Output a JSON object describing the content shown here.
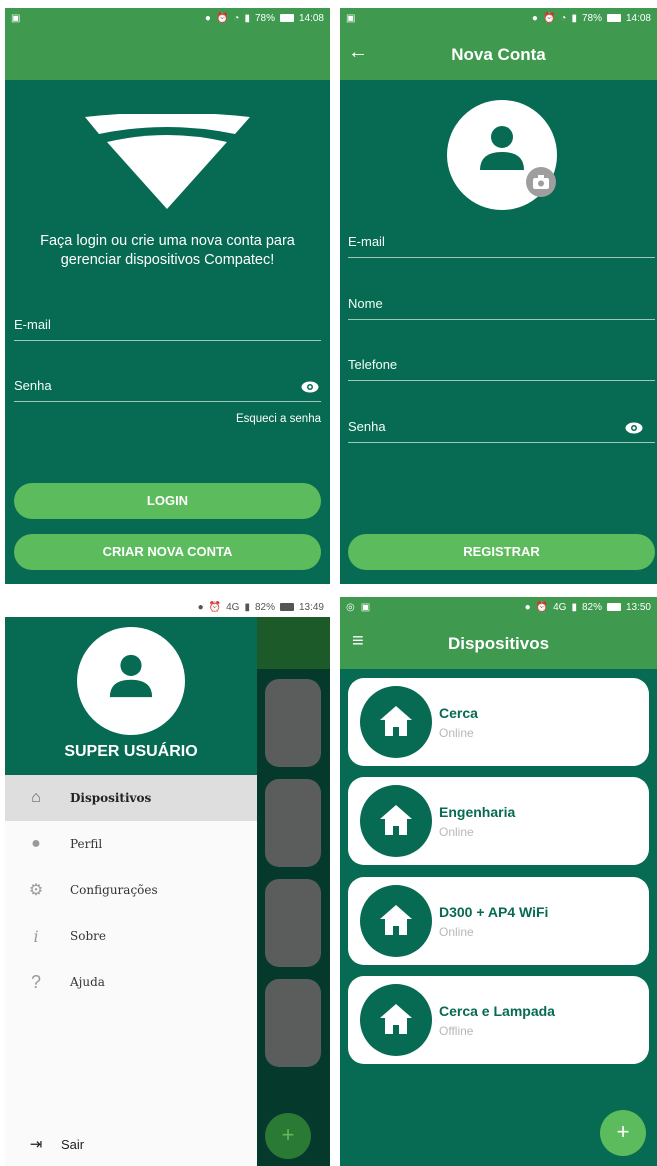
{
  "status1": {
    "battery": "78%",
    "time": "14:08"
  },
  "status2": {
    "battery": "78%",
    "time": "14:08"
  },
  "status3": {
    "network": "4G",
    "battery": "82%",
    "time": "13:49"
  },
  "status4": {
    "network": "4G",
    "battery": "82%",
    "time": "13:50"
  },
  "login": {
    "welcome": "Faça login ou crie uma nova conta para gerenciar dispositivos Compatec!",
    "email_label": "E-mail",
    "password_label": "Senha",
    "forgot": "Esqueci a senha",
    "login_button": "LOGIN",
    "create_button": "CRIAR NOVA CONTA"
  },
  "register": {
    "title": "Nova Conta",
    "email_label": "E-mail",
    "name_label": "Nome",
    "phone_label": "Telefone",
    "password_label": "Senha",
    "register_button": "REGISTRAR"
  },
  "drawer": {
    "user_name": "SUPER USUÁRIO",
    "items": [
      {
        "label": "Dispositivos",
        "icon": "home-icon"
      },
      {
        "label": "Perfil",
        "icon": "person-icon"
      },
      {
        "label": "Configurações",
        "icon": "gear-icon"
      },
      {
        "label": "Sobre",
        "icon": "info-icon"
      },
      {
        "label": "Ajuda",
        "icon": "help-icon"
      }
    ],
    "logout": "Sair",
    "fab": "+"
  },
  "devices": {
    "title": "Dispositivos",
    "items": [
      {
        "name": "Cerca",
        "status": "Online"
      },
      {
        "name": "Engenharia",
        "status": "Online"
      },
      {
        "name": "D300 + AP4 WiFi",
        "status": "Online"
      },
      {
        "name": "Cerca e Lampada",
        "status": "Offline"
      }
    ],
    "fab": "+"
  },
  "colors": {
    "primary_dark": "#076a52",
    "accent": "#5cbb5d",
    "appbar": "#3f9a4f"
  }
}
